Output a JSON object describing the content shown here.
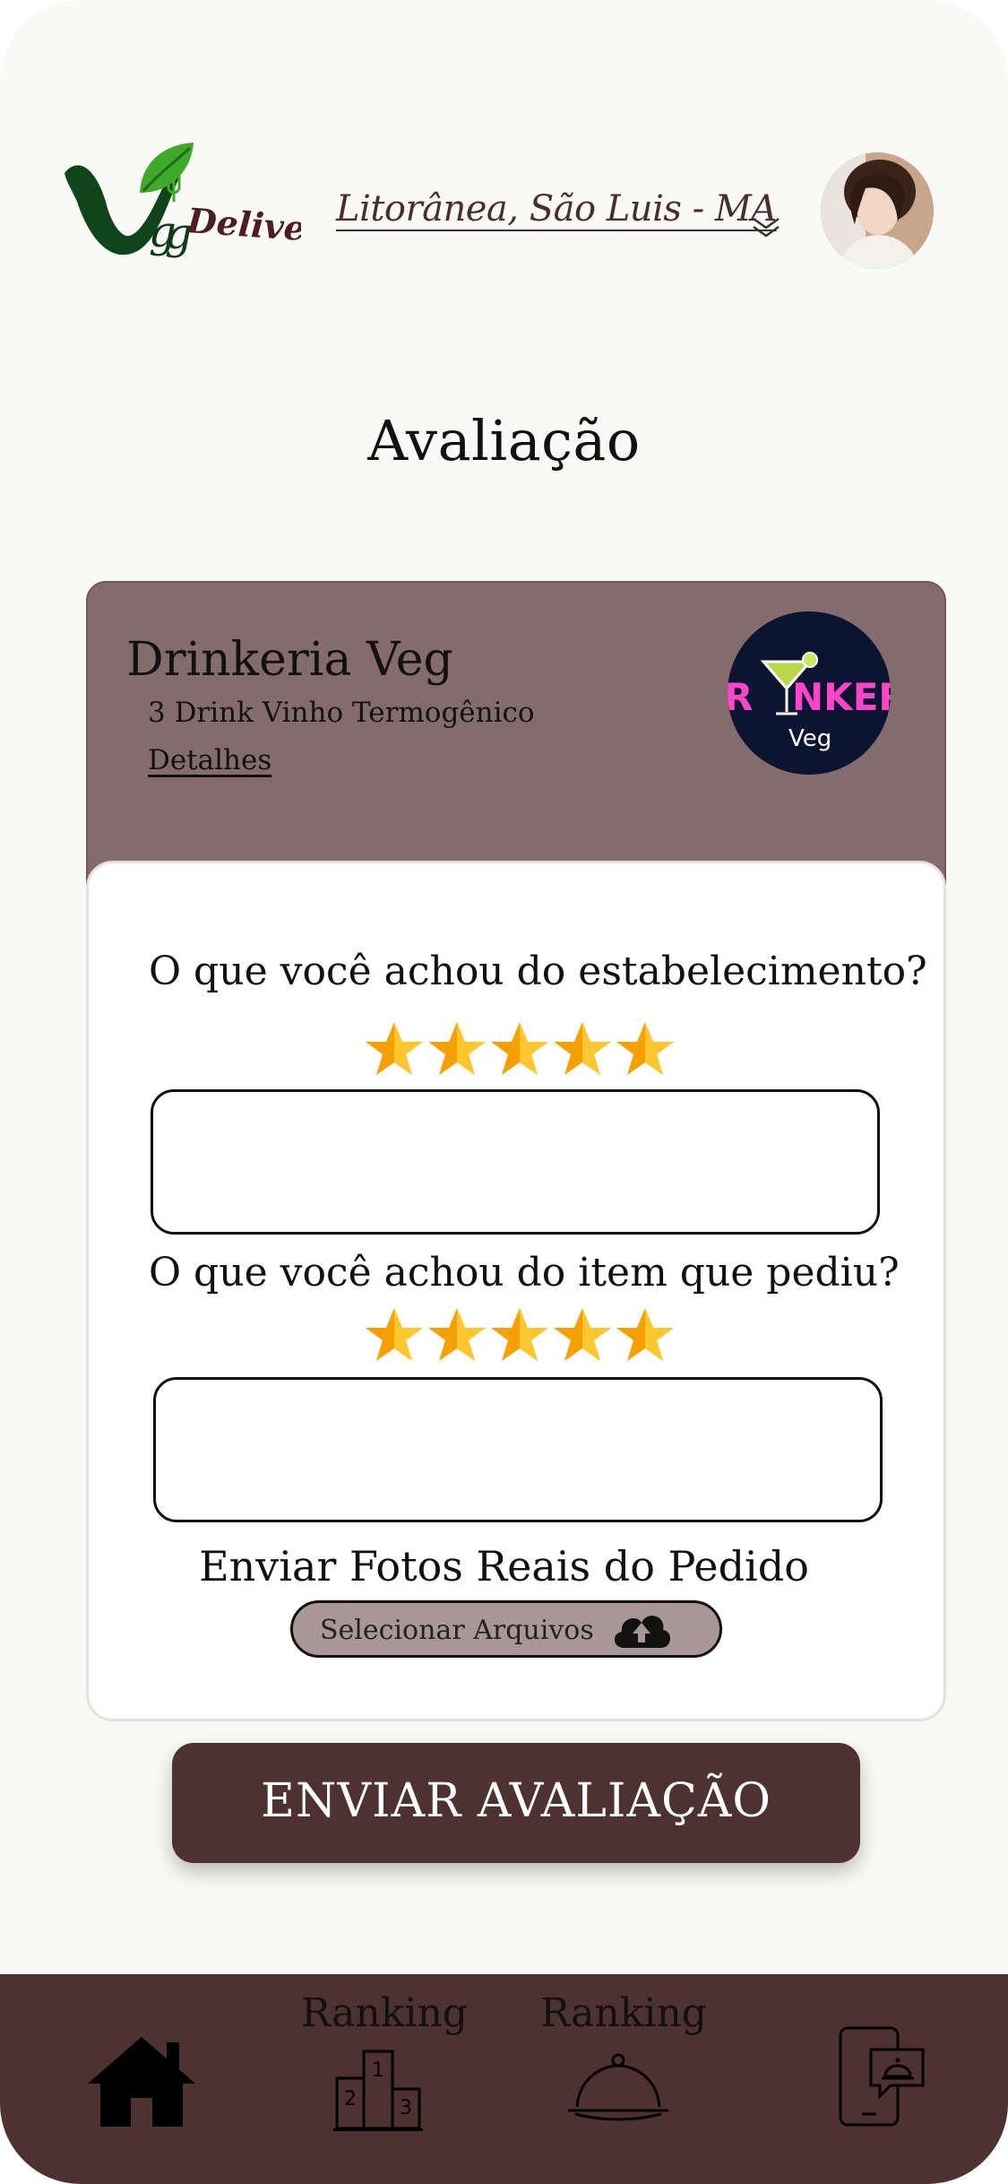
{
  "header": {
    "location": "Litorânea, São Luis - MA"
  },
  "page": {
    "title": "Avaliação"
  },
  "restaurant": {
    "name": "Drinkeria Veg",
    "item": "3 Drink Vinho Termogênico",
    "details_link": "Detalhes"
  },
  "review": {
    "establishment_question": "O que você achou do estabelecimento?",
    "establishment_rating": 5,
    "establishment_comment": "",
    "item_question": "O que você achou do item que pediu?",
    "item_rating": 5,
    "item_comment": "",
    "photos_label": "Enviar Fotos Reais do Pedido",
    "file_button_label": "Selecionar Arquivos",
    "submit_label": "ENVIAR AVALIAÇÃO"
  },
  "bottom_nav": {
    "items": [
      {
        "icon": "home-icon",
        "caption": ""
      },
      {
        "icon": "podium-icon",
        "caption": "Ranking"
      },
      {
        "icon": "cloche-icon",
        "caption": "Ranking"
      },
      {
        "icon": "phone-support-icon",
        "caption": ""
      }
    ]
  },
  "colors": {
    "brand_dark": "#4e3131",
    "card_header": "#856c6c",
    "file_button": "#a89796",
    "star": "#f5a000"
  }
}
